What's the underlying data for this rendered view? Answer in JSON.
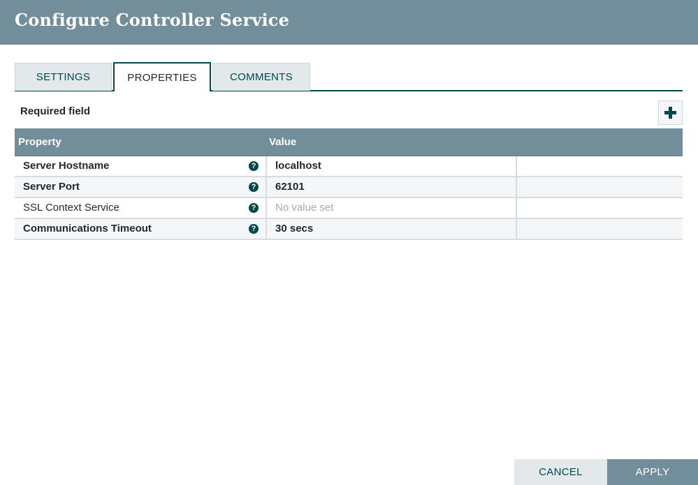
{
  "dialog": {
    "title": "Configure Controller Service"
  },
  "tabs": [
    {
      "label": "SETTINGS",
      "active": false
    },
    {
      "label": "PROPERTIES",
      "active": true
    },
    {
      "label": "COMMENTS",
      "active": false
    }
  ],
  "properties_panel": {
    "required_label": "Required field",
    "add_button_icon": "plus-icon",
    "columns": {
      "property": "Property",
      "value": "Value"
    },
    "rows": [
      {
        "property": "Server Hostname",
        "value": "localhost",
        "required": true,
        "value_set": true,
        "help_icon": "question-circle-icon"
      },
      {
        "property": "Server Port",
        "value": "62101",
        "required": true,
        "value_set": true,
        "help_icon": "question-circle-icon"
      },
      {
        "property": "SSL Context Service",
        "value": "No value set",
        "required": false,
        "value_set": false,
        "help_icon": "question-circle-icon"
      },
      {
        "property": "Communications Timeout",
        "value": "30 secs",
        "required": true,
        "value_set": true,
        "help_icon": "question-circle-icon"
      }
    ]
  },
  "footer": {
    "cancel_label": "CANCEL",
    "apply_label": "APPLY"
  },
  "colors": {
    "header_bg": "#728e9b",
    "accent": "#004849",
    "tab_inactive_bg": "#e3e8eb",
    "row_alt_bg": "#f4f6f7",
    "unset_text": "#a8a8a8"
  }
}
